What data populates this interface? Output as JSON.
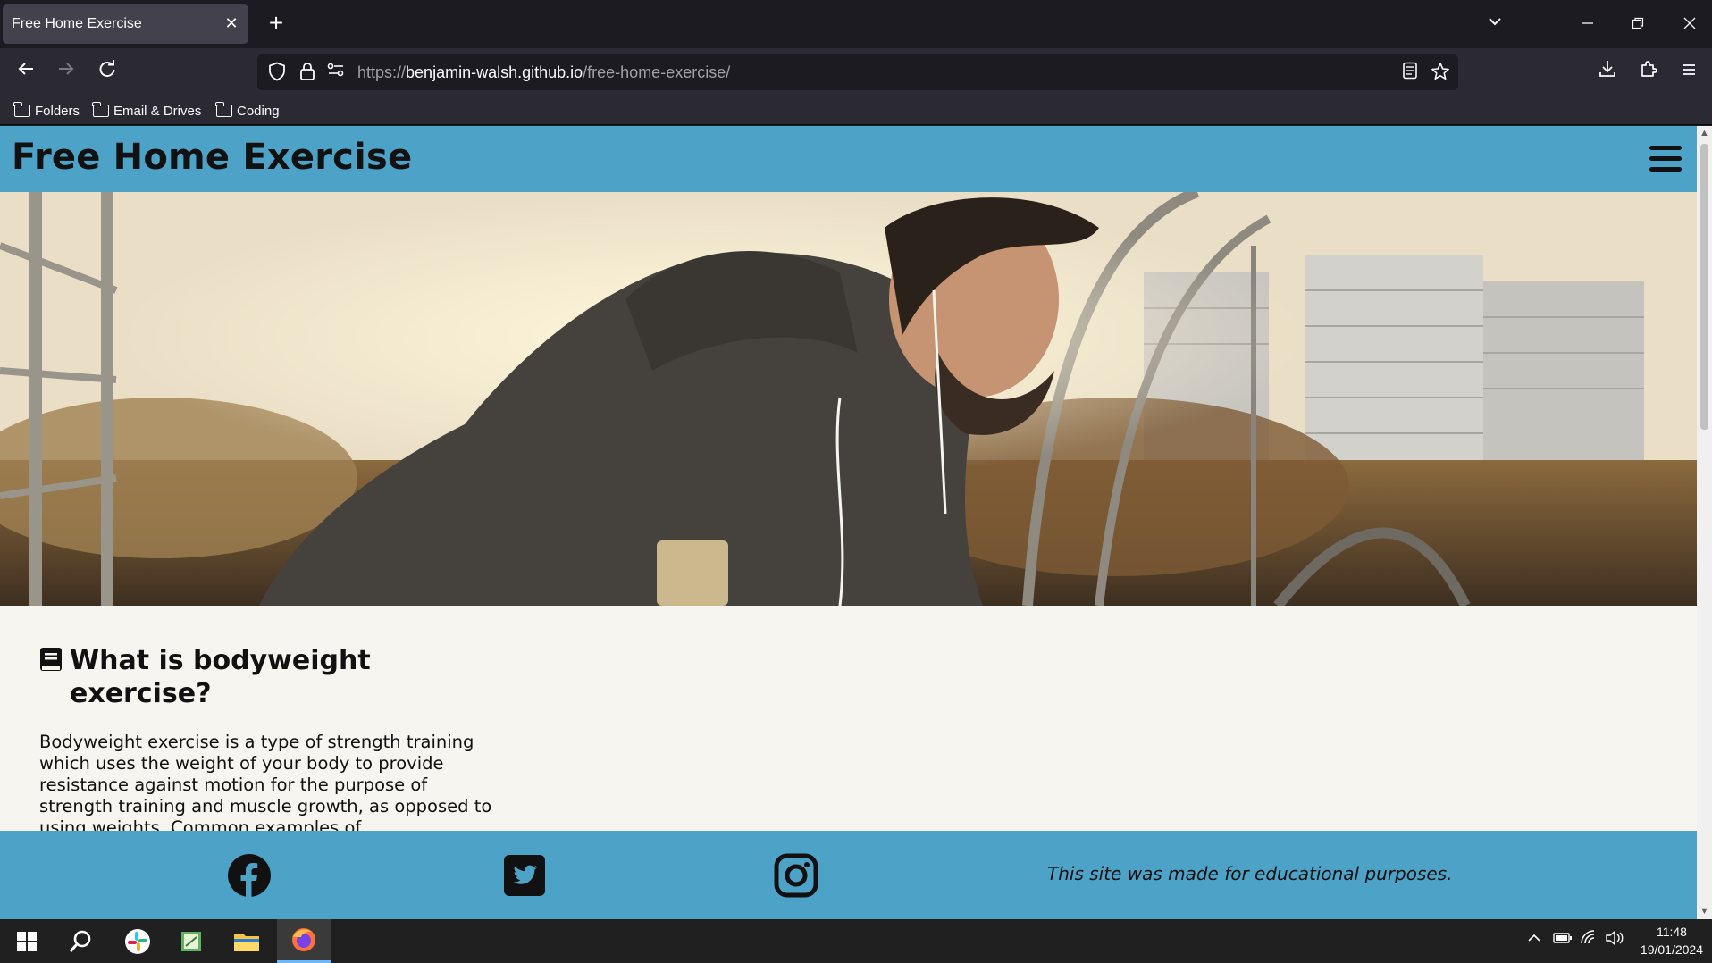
{
  "browser": {
    "tab_title": "Free Home Exercise",
    "tab_close": "✕",
    "new_tab": "+",
    "url_scheme": "https://",
    "url_host": "benjamin-walsh.github.io",
    "url_path": "/free-home-exercise/",
    "bookmarks": [
      "Folders",
      "Email & Drives",
      "Coding"
    ]
  },
  "site": {
    "title": "Free Home Exercise",
    "section_heading": "What is bodyweight exercise?",
    "section_body": "Bodyweight exercise is a type of strength training which uses the weight of your body to provide resistance against motion for the purpose of strength training and muscle growth, as opposed to using weights. Common examples of",
    "footer_note": "This site was made for educational purposes.",
    "header_color": "#4ca3c7"
  },
  "taskbar": {
    "time": "11:48",
    "date": "19/01/2024"
  }
}
